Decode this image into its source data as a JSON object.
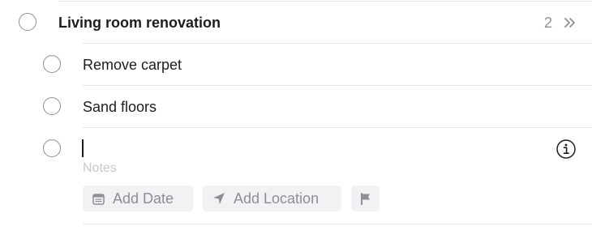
{
  "parent_task": {
    "title": "Living room renovation",
    "count": "2",
    "chevron_icon": "double-chevron-right-icon"
  },
  "subtasks": [
    {
      "title": "Remove carpet"
    },
    {
      "title": "Sand floors"
    }
  ],
  "new_task": {
    "title_value": "",
    "notes_placeholder": "Notes",
    "info_icon": "info-icon"
  },
  "actions": {
    "add_date_label": "Add Date",
    "add_date_icon": "calendar-icon",
    "add_location_label": "Add Location",
    "add_location_icon": "location-arrow-icon",
    "flag_icon": "flag-icon"
  },
  "colors": {
    "separator": "#e5e5e7",
    "circle_stroke": "#8e8e93",
    "muted_text": "#8e8e93",
    "chip_background": "#f2f2f4",
    "placeholder": "#c7c7cc"
  }
}
